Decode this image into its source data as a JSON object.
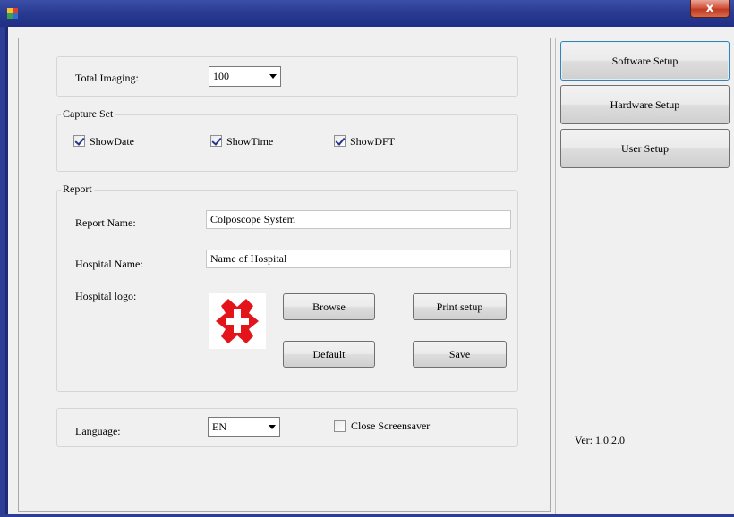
{
  "window": {
    "close_glyph": "x",
    "icon": "app-grid-icon"
  },
  "colors": {
    "titlebar": "#2a3b92",
    "close": "#c23a22",
    "logo_red": "#e4141b",
    "checkbox_mark": "#23358a"
  },
  "imaging": {
    "label": "Total Imaging:",
    "value": "100"
  },
  "capture": {
    "legend": "Capture Set",
    "items": [
      {
        "label": "ShowDate",
        "checked": true
      },
      {
        "label": "ShowTime",
        "checked": true
      },
      {
        "label": "ShowDFT",
        "checked": true
      }
    ]
  },
  "report": {
    "legend": "Report",
    "report_name_label": "Report Name:",
    "report_name_value": "Colposcope System",
    "hospital_name_label": "Hospital Name:",
    "hospital_name_value": "Name of Hospital",
    "logo_label": "Hospital logo:",
    "browse": "Browse",
    "print_setup": "Print setup",
    "default": "Default",
    "save": "Save"
  },
  "language": {
    "label": "Language:",
    "value": "EN",
    "screensaver_label": "Close Screensaver",
    "screensaver_checked": false
  },
  "side": {
    "software_setup": "Software Setup",
    "hardware_setup": "Hardware Setup",
    "user_setup": "User Setup",
    "version": "Ver: 1.0.2.0"
  }
}
